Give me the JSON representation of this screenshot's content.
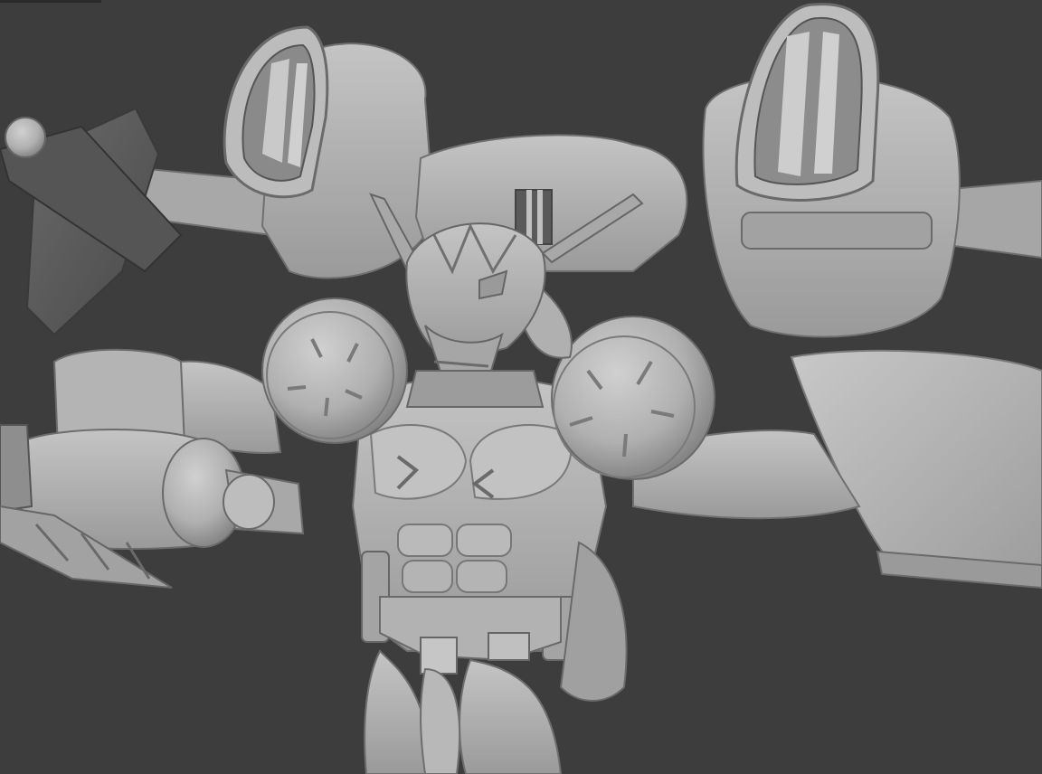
{
  "viewport": {
    "kind": "3d-viewport",
    "shading": "solid",
    "background_color": "#3d3d3d",
    "model_color": "#b8b8b8",
    "model_shadow_color": "#8a8a8a",
    "model_highlight_color": "#d2d2d2",
    "dark_part_color": "#5c5c5c"
  }
}
